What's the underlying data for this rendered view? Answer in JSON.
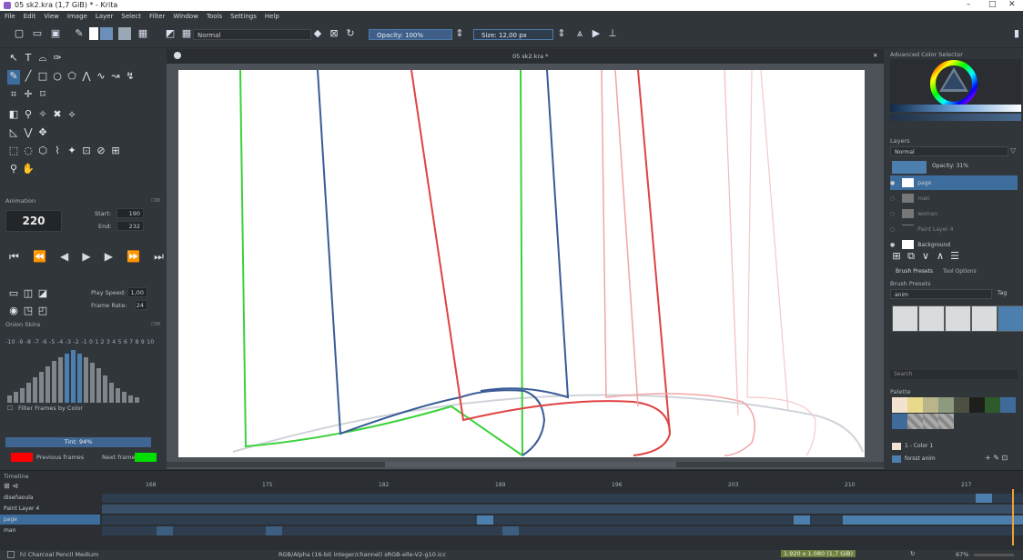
{
  "window": {
    "title": "05 sk2.kra (1,7 GiB) * - Krita",
    "controls": [
      "–",
      "□",
      "✕"
    ]
  },
  "menu": [
    "File",
    "Edit",
    "View",
    "Image",
    "Layer",
    "Select",
    "Filter",
    "Window",
    "Tools",
    "Settings",
    "Help"
  ],
  "toolbar": {
    "blend_mode": "Normal",
    "opacity": "Opacity: 100%",
    "size": "Size: 12,00 px"
  },
  "canvas": {
    "tab_title": "05 sk2.kra *"
  },
  "animation": {
    "title": "Animation",
    "current_frame": "220",
    "start_label": "Start:",
    "start_value": "190",
    "end_label": "End:",
    "end_value": "232",
    "play_speed_label": "Play Speed:",
    "play_speed_value": "1,00",
    "frame_rate_label": "Frame Rate:",
    "frame_rate_value": "24"
  },
  "onion": {
    "title": "Onion Skins",
    "numbers": "-10 -9 -8 -7 -6 -5 -4 -3 -2 -1  0  1  2  3  4  5  6  7  8  9  10",
    "filter_label": "Filter Frames by Color",
    "tint": "Tint: 94%",
    "previous_label": "Previous frames",
    "next_label": "Next frames",
    "previous_color": "#ff0000",
    "next_color": "#00e000"
  },
  "color_selector": {
    "title": "Advanced Color Selector"
  },
  "layers": {
    "title": "Layers",
    "blend_mode": "Normal",
    "opacity": "Opacity: 31%",
    "items": [
      {
        "name": "page",
        "selected": true,
        "dim": false
      },
      {
        "name": "man",
        "selected": false,
        "dim": true
      },
      {
        "name": "woman",
        "selected": false,
        "dim": true
      },
      {
        "name": "Paint Layer 4",
        "selected": false,
        "dim": true
      },
      {
        "name": "Background",
        "selected": false,
        "dim": false
      }
    ]
  },
  "presets": {
    "tab1": "Brush Presets",
    "tab2": "Tool Options",
    "title": "Brush Presets",
    "filter": "anim",
    "tag": "Tag",
    "search_placeholder": "Search"
  },
  "palette": {
    "title": "Palette",
    "swatches": [
      "#f2e3d0",
      "#e9d98a",
      "#b9b48a",
      "#8d9a7e",
      "#4c4f42",
      "#1d1f1c",
      "#2f5a2b",
      "#3e6b9a"
    ],
    "color_name": "1 - Color 1",
    "palette_name": "forsst anim"
  },
  "timeline": {
    "title": "Timeline",
    "ticks": [
      "168",
      "175",
      "182",
      "189",
      "196",
      "203",
      "210",
      "217"
    ],
    "layers": [
      "diseñaoula",
      "Paint Layer 4",
      "page",
      "man"
    ]
  },
  "status": {
    "brush": "h) Charcoal Pencil Medium",
    "color_space": "RGB/Alpha (16-bit integer/channel)  sRGB-elle-V2-g10.icc",
    "dimensions": "1.920 x 1.080 (1,7 GiB)",
    "zoom": "67%"
  }
}
